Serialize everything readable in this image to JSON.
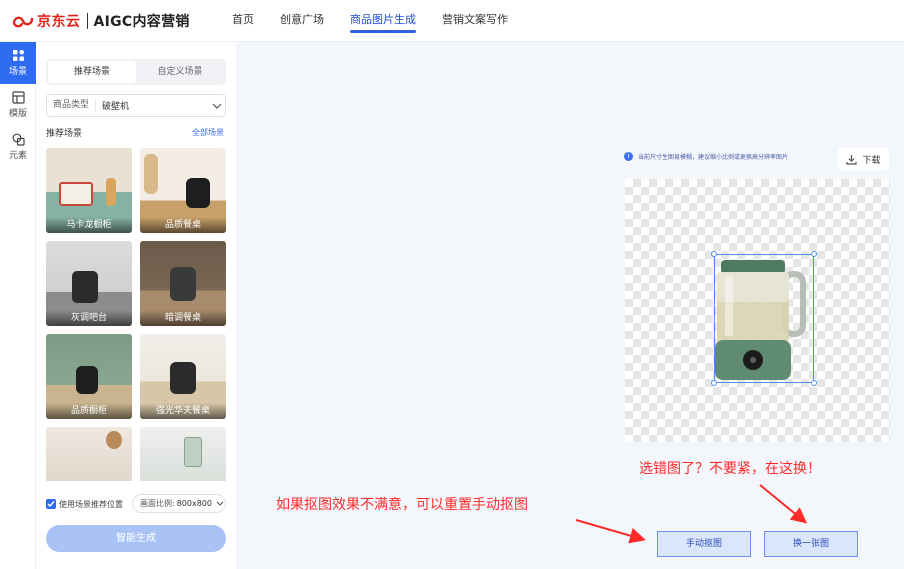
{
  "brand": {
    "name": "京东云",
    "product": "AIGC内容营销"
  },
  "nav": [
    {
      "label": "首页",
      "active": false
    },
    {
      "label": "创意广场",
      "active": false
    },
    {
      "label": "商品图片生成",
      "active": true
    },
    {
      "label": "营销文案写作",
      "active": false
    }
  ],
  "rail": [
    {
      "label": "场景",
      "icon": "scene-icon",
      "active": true
    },
    {
      "label": "模版",
      "icon": "template-icon",
      "active": false
    },
    {
      "label": "元素",
      "icon": "element-icon",
      "active": false
    }
  ],
  "panel": {
    "tabs": [
      {
        "label": "推荐场景",
        "active": true
      },
      {
        "label": "自定义场景",
        "active": false
      }
    ],
    "category": {
      "label": "商品类型",
      "value": "破壁机"
    },
    "rec_title": "推荐场景",
    "rec_all": "全部场景",
    "scenes": [
      {
        "label": "马卡龙橱柜",
        "color_top": "#e9e2d4",
        "color_bottom": "#86b2a3"
      },
      {
        "label": "品质餐桌",
        "color_top": "#f3ede5",
        "color_bottom": "#c8a06a"
      },
      {
        "label": "灰调吧台",
        "color_top": "#dcdcdc",
        "color_bottom": "#8c8c8c"
      },
      {
        "label": "暗调餐桌",
        "color_top": "#6b5a4a",
        "color_bottom": "#a88b6a"
      },
      {
        "label": "品质橱柜",
        "color_top": "#7c9a84",
        "color_bottom": "#c9b48f"
      },
      {
        "label": "强光华夫餐桌",
        "color_top": "#f1efe9",
        "color_bottom": "#d7c6a7"
      },
      {
        "label": "",
        "color_top": "#efe8df",
        "color_bottom": "#d8cfc2"
      },
      {
        "label": "",
        "color_top": "#eef0ee",
        "color_bottom": "#cfd5cf"
      }
    ],
    "use_scene_position": "使用场景推荐位置",
    "ratio": {
      "label": "画面比例:",
      "value": "800x800"
    },
    "generate": "智能生成"
  },
  "main": {
    "notice": "当前尺寸生图易模糊，建议缩小比例或更换高分辨率图片",
    "download": "下载",
    "hint_replace": "选错图了？不要紧，在这换！",
    "hint_manual": "如果抠图效果不满意，可以重置手动抠图",
    "manual_cutout": "手动抠图",
    "replace_image": "换一张图"
  },
  "colors": {
    "accent": "#2f6bf0",
    "brand_red": "#e1251b",
    "annotation_red": "#ff2a2a"
  }
}
